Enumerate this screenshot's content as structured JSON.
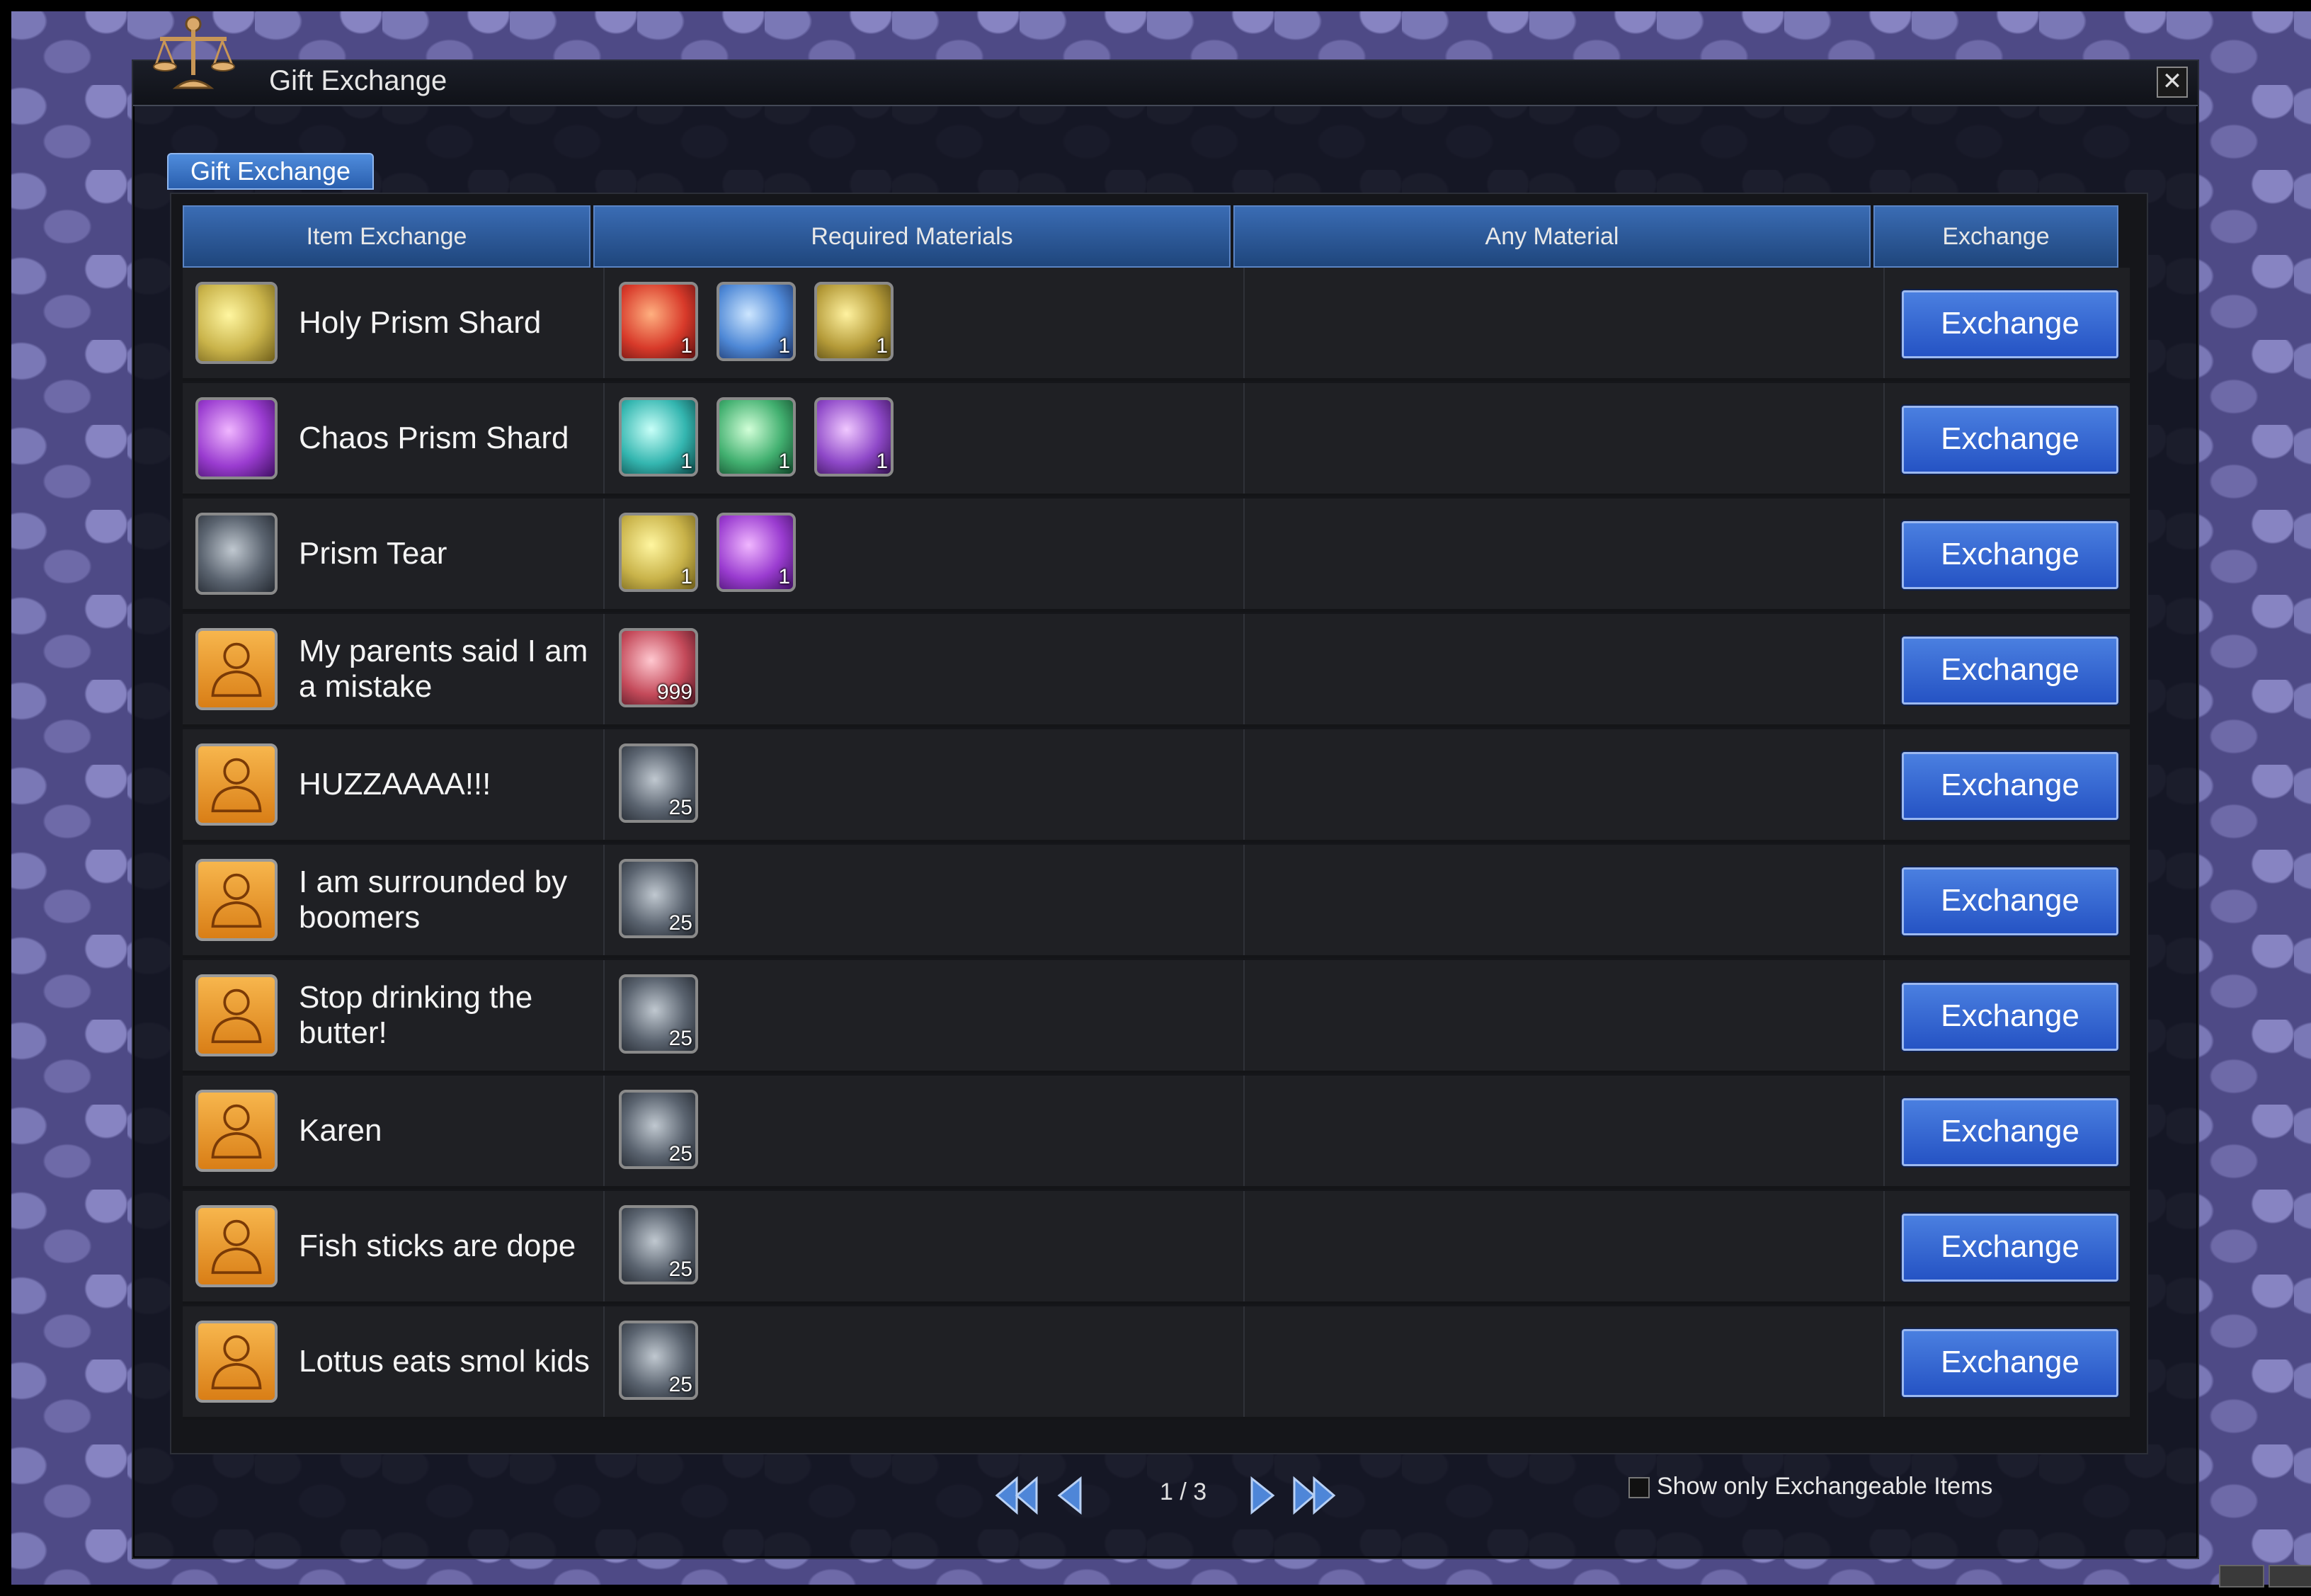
{
  "window": {
    "title": "Gift Exchange",
    "tab": "Gift Exchange"
  },
  "table": {
    "headers": [
      "Item Exchange",
      "Required Materials",
      "Any Material",
      "Exchange"
    ],
    "rows": [
      {
        "name": "Holy Prism Shard",
        "icon": "holy-prism-shard-icon",
        "materials": [
          {
            "icon": "red-shard-icon",
            "count": "1"
          },
          {
            "icon": "blue-shard-icon",
            "count": "1"
          },
          {
            "icon": "gold-shard-icon",
            "count": "1"
          }
        ],
        "button": "Exchange"
      },
      {
        "name": "Chaos Prism Shard",
        "icon": "chaos-prism-shard-icon",
        "materials": [
          {
            "icon": "cyan-shard-icon",
            "count": "1"
          },
          {
            "icon": "green-shard-icon",
            "count": "1"
          },
          {
            "icon": "violet-shard-icon",
            "count": "1"
          }
        ],
        "button": "Exchange"
      },
      {
        "name": "Prism Tear",
        "icon": "prism-tear-icon",
        "materials": [
          {
            "icon": "holy-prism-shard-icon",
            "count": "1"
          },
          {
            "icon": "chaos-prism-shard-icon",
            "count": "1"
          }
        ],
        "button": "Exchange"
      },
      {
        "name": "My parents said I am a mistake",
        "icon": "title-person-icon",
        "materials": [
          {
            "icon": "pink-shard-icon",
            "count": "999"
          }
        ],
        "button": "Exchange"
      },
      {
        "name": "HUZZAAAA!!!",
        "icon": "title-person-icon",
        "materials": [
          {
            "icon": "prism-tear-icon",
            "count": "25"
          }
        ],
        "button": "Exchange"
      },
      {
        "name": "I am surrounded by boomers",
        "icon": "title-person-icon",
        "materials": [
          {
            "icon": "prism-tear-icon",
            "count": "25"
          }
        ],
        "button": "Exchange"
      },
      {
        "name": "Stop drinking the butter!",
        "icon": "title-person-icon",
        "materials": [
          {
            "icon": "prism-tear-icon",
            "count": "25"
          }
        ],
        "button": "Exchange"
      },
      {
        "name": "Karen",
        "icon": "title-person-icon",
        "materials": [
          {
            "icon": "prism-tear-icon",
            "count": "25"
          }
        ],
        "button": "Exchange"
      },
      {
        "name": "Fish sticks are dope",
        "icon": "title-person-icon",
        "materials": [
          {
            "icon": "prism-tear-icon",
            "count": "25"
          }
        ],
        "button": "Exchange"
      },
      {
        "name": "Lottus eats smol kids",
        "icon": "title-person-icon",
        "materials": [
          {
            "icon": "prism-tear-icon",
            "count": "25"
          }
        ],
        "button": "Exchange"
      }
    ]
  },
  "pagination": {
    "page_text": "1 / 3"
  },
  "filter": {
    "label": "Show only Exchangeable Items",
    "checked": false
  },
  "colors": {
    "header_blue": "#2f5c9e",
    "button_blue": "#3568d4",
    "person_orange": "#f0a030"
  }
}
